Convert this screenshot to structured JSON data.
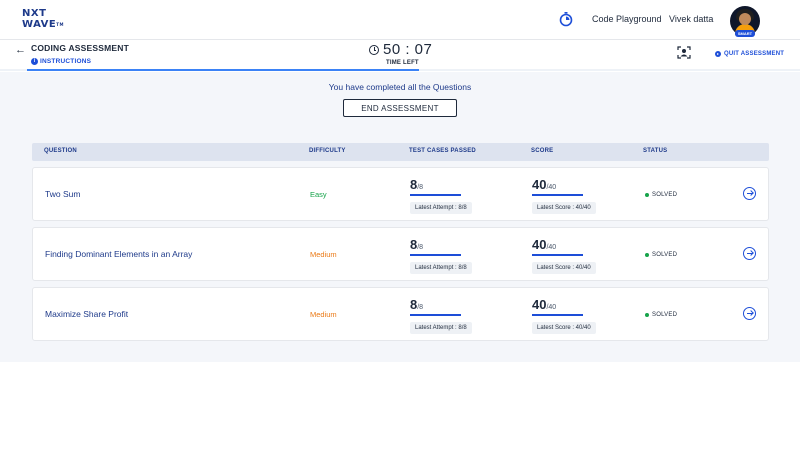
{
  "brand": {
    "line1": "NXT",
    "line2": "WAVE",
    "tm": "TM"
  },
  "navbar": {
    "playground_label": "Code Playground",
    "user_name": "Vivek datta",
    "avatar_badge": "SMART"
  },
  "assessment": {
    "title": "CODING ASSESSMENT",
    "instructions_label": "INSTRUCTIONS",
    "timer": "50 : 07",
    "time_left_label": "TIME LEFT",
    "quit_label": "QUIT ASSESSMENT",
    "time_progress": 0.49
  },
  "completion": {
    "message": "You have completed all the Questions",
    "end_button": "END ASSESSMENT"
  },
  "table": {
    "headers": {
      "question": "QUESTION",
      "difficulty": "DIFFICULTY",
      "tests": "TEST CASES PASSED",
      "score": "SCORE",
      "status": "STATUS"
    },
    "rows": [
      {
        "question": "Two Sum",
        "difficulty": "Easy",
        "passed": "8",
        "total": "/8",
        "attempt": "Latest Attempt : 8/8",
        "score": "40",
        "max": "/40",
        "latest_score": "Latest Score : 40/40",
        "status": "SOLVED",
        "pass_fraction": 1,
        "score_fraction": 1
      },
      {
        "question": "Finding Dominant Elements in an Array",
        "difficulty": "Medium",
        "passed": "8",
        "total": "/8",
        "attempt": "Latest Attempt : 8/8",
        "score": "40",
        "max": "/40",
        "latest_score": "Latest Score : 40/40",
        "status": "SOLVED",
        "pass_fraction": 1,
        "score_fraction": 1
      },
      {
        "question": "Maximize Share Profit",
        "difficulty": "Medium",
        "passed": "8",
        "total": "/8",
        "attempt": "Latest Attempt : 8/8",
        "score": "40",
        "max": "/40",
        "latest_score": "Latest Score : 40/40",
        "status": "SOLVED",
        "pass_fraction": 1,
        "score_fraction": 1
      }
    ]
  },
  "colors": {
    "primary": "#1d4ed8",
    "easy": "#16a34a",
    "medium": "#ea7a17",
    "solved": "#16a34a"
  },
  "icons": {
    "stopwatch": "stopwatch-icon",
    "back": "arrow-left-icon",
    "info": "info-icon",
    "clock": "clock-icon",
    "proctor": "proctor-camera-icon",
    "quit": "play-circle-icon",
    "go": "arrow-right-circle-icon"
  }
}
